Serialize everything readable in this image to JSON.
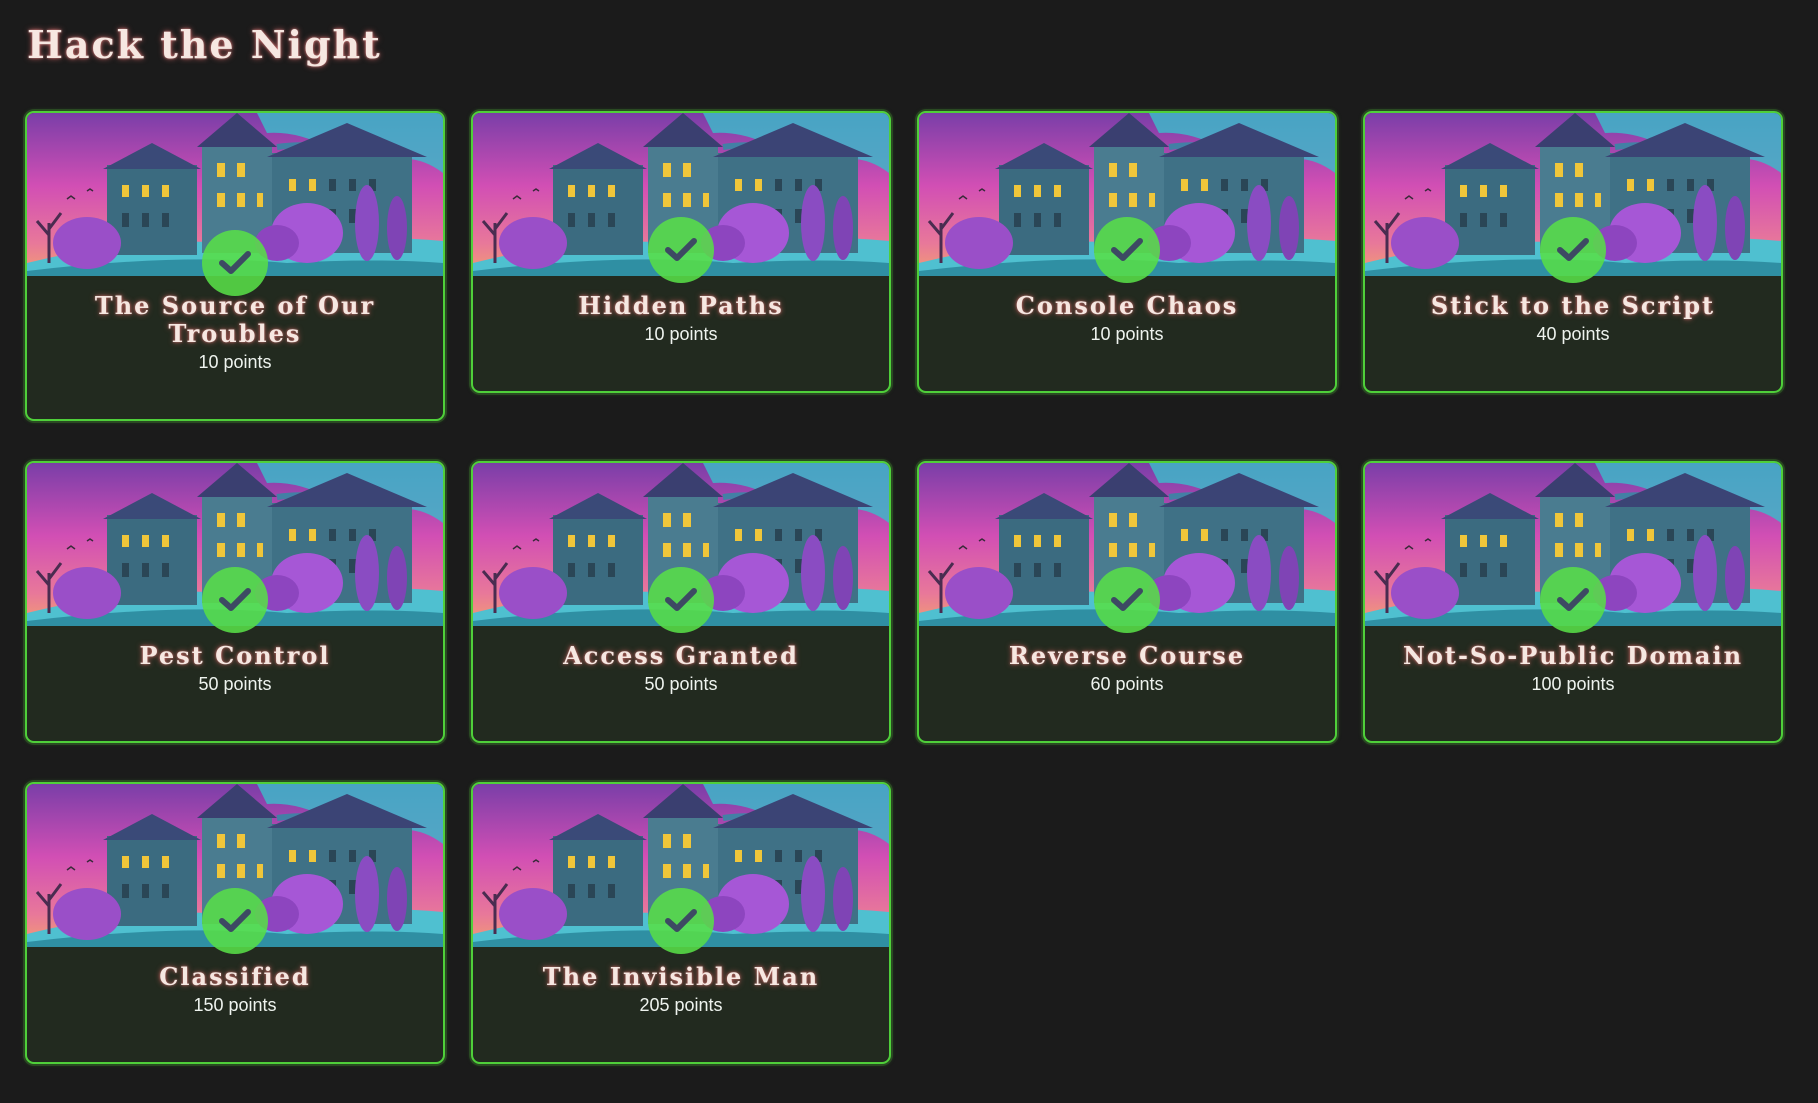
{
  "page": {
    "title": "Hack the Night"
  },
  "colors": {
    "background": "#1b1b1b",
    "card_background": "#222a1f",
    "card_border": "#4fcf3a",
    "check_badge": "#58de48",
    "check_mark": "#3d4a63",
    "title_text": "#f6e7e1"
  },
  "icons": {
    "completed": "check-icon",
    "thumbnail": "haunted-mansion-image"
  },
  "challenges": [
    {
      "title": "The Source of Our Troubles",
      "points": "10 points",
      "completed": true
    },
    {
      "title": "Hidden Paths",
      "points": "10 points",
      "completed": true
    },
    {
      "title": "Console Chaos",
      "points": "10 points",
      "completed": true
    },
    {
      "title": "Stick to the Script",
      "points": "40 points",
      "completed": true
    },
    {
      "title": "Pest Control",
      "points": "50 points",
      "completed": true
    },
    {
      "title": "Access Granted",
      "points": "50 points",
      "completed": true
    },
    {
      "title": "Reverse Course",
      "points": "60 points",
      "completed": true
    },
    {
      "title": "Not-So-Public Domain",
      "points": "100 points",
      "completed": true
    },
    {
      "title": "Classified",
      "points": "150 points",
      "completed": true
    },
    {
      "title": "The Invisible Man",
      "points": "205 points",
      "completed": true
    }
  ]
}
